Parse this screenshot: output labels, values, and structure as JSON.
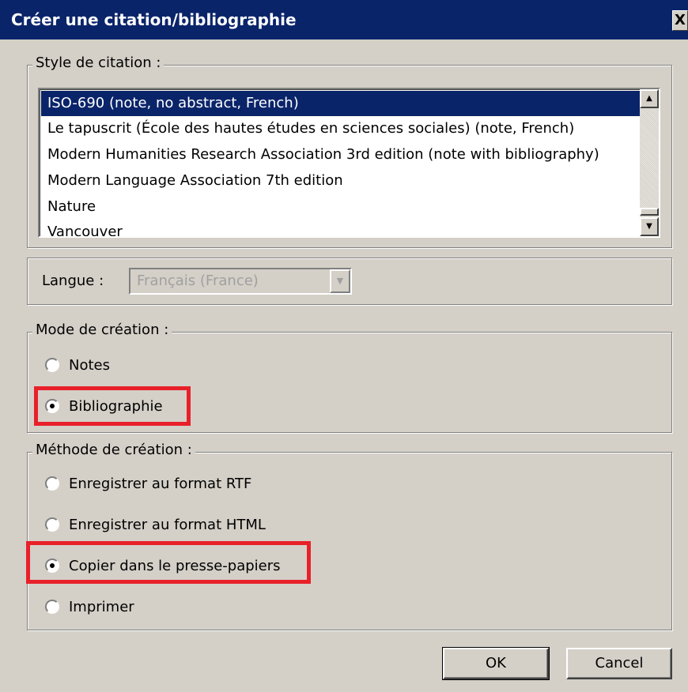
{
  "window": {
    "title": "Créer une citation/bibliographie",
    "close_label": "X"
  },
  "citation_style": {
    "legend": "Style de citation :",
    "items": [
      {
        "label": "ISO-690 (note, no abstract, French)",
        "selected": true
      },
      {
        "label": "Le tapuscrit (École des hautes études en sciences sociales) (note, French)",
        "selected": false
      },
      {
        "label": "Modern Humanities Research Association 3rd edition (note with bibliography)",
        "selected": false
      },
      {
        "label": "Modern Language Association 7th edition",
        "selected": false
      },
      {
        "label": "Nature",
        "selected": false
      },
      {
        "label": "Vancouver",
        "selected": false
      }
    ]
  },
  "language": {
    "label": "Langue :",
    "value": "Français (France)",
    "disabled": true
  },
  "output_mode": {
    "legend": "Mode de création :",
    "options": [
      {
        "label": "Notes",
        "checked": false
      },
      {
        "label": "Bibliographie",
        "checked": true,
        "highlighted": true
      }
    ]
  },
  "output_method": {
    "legend": "Méthode de création :",
    "options": [
      {
        "label": "Enregistrer au format RTF",
        "checked": false
      },
      {
        "label": "Enregistrer au format HTML",
        "checked": false
      },
      {
        "label": "Copier dans le presse-papiers",
        "checked": true,
        "highlighted": true
      },
      {
        "label": "Imprimer",
        "checked": false
      }
    ]
  },
  "buttons": {
    "ok": "OK",
    "cancel": "Cancel"
  },
  "colors": {
    "titlebar": "#0a246a",
    "dialog_bg": "#d4d0c8",
    "highlight_box": "#e8202a"
  }
}
